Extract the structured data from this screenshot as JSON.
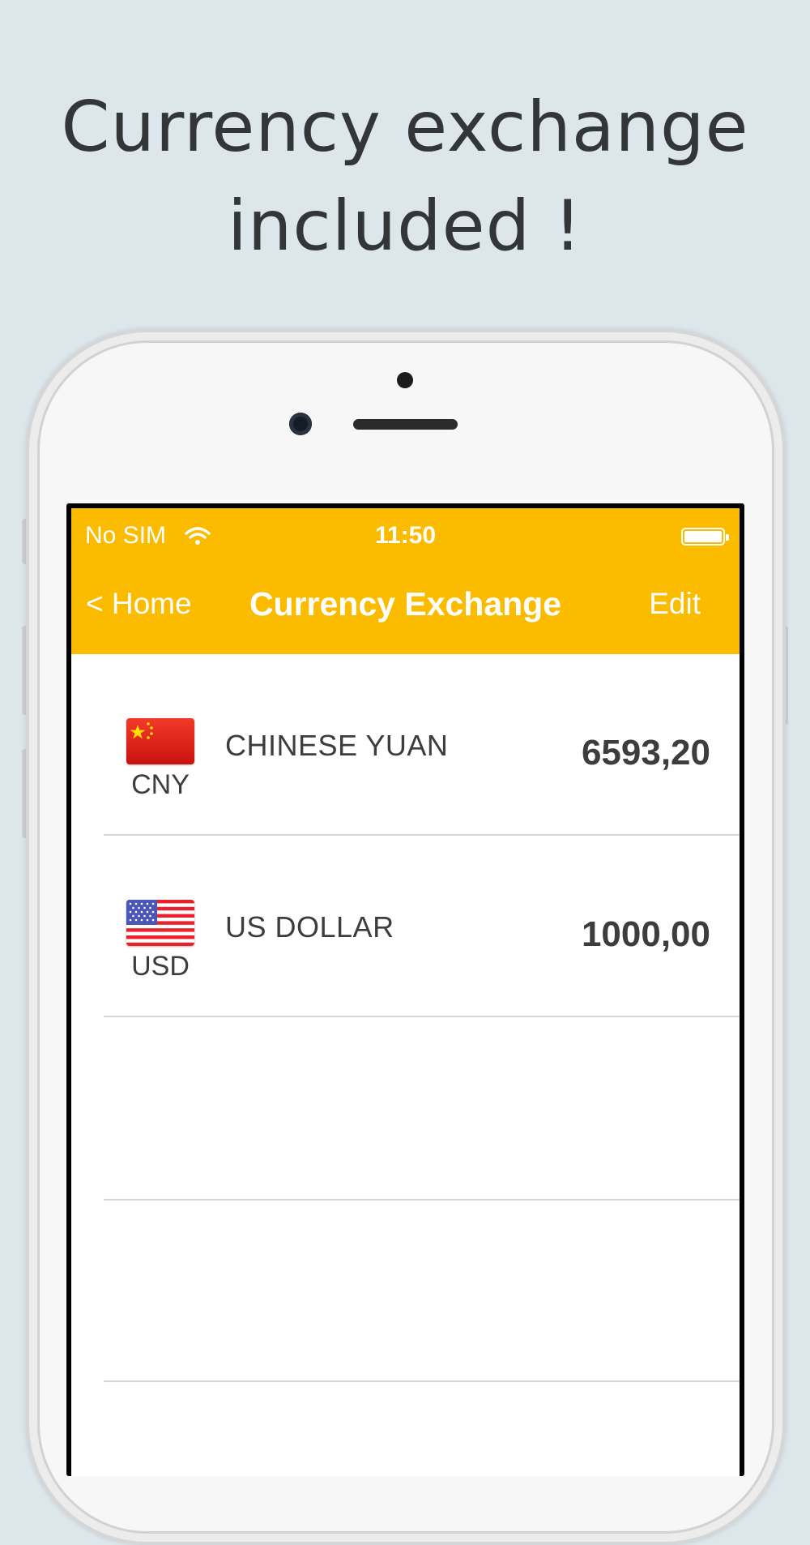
{
  "headline": {
    "line1": "Currency exchange",
    "line2": "included !"
  },
  "status_bar": {
    "carrier": "No SIM",
    "time": "11:50"
  },
  "nav": {
    "back_label": "< Home",
    "title": "Currency Exchange",
    "edit_label": "Edit"
  },
  "colors": {
    "accent": "#fbbc00",
    "background": "#dde6ea",
    "text": "#3d3d3d"
  },
  "currencies": [
    {
      "code": "CNY",
      "name": "CHINESE YUAN",
      "amount": "6593,20",
      "flag_icon": "china-flag-icon"
    },
    {
      "code": "USD",
      "name": "US DOLLAR",
      "amount": "1000,00",
      "flag_icon": "usa-flag-icon"
    }
  ]
}
